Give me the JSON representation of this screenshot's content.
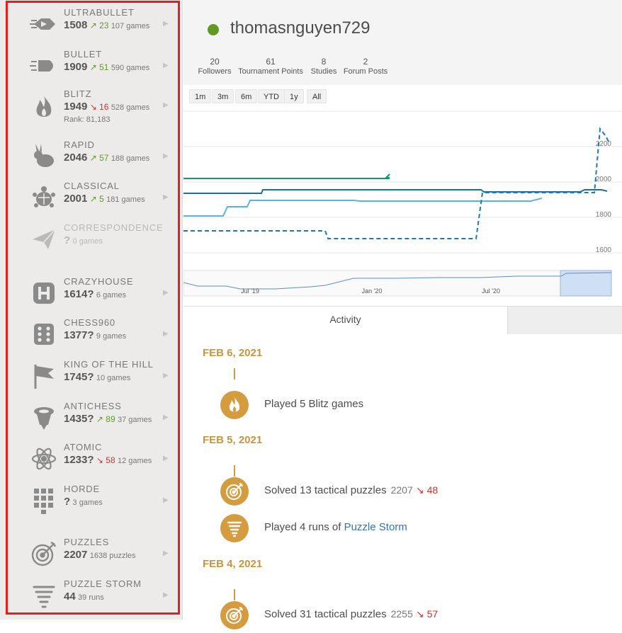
{
  "user": {
    "username": "thomasnguyen729",
    "online_color": "#629924"
  },
  "stats": [
    {
      "value": "20",
      "label": "Followers"
    },
    {
      "value": "61",
      "label": "Tournament Points"
    },
    {
      "value": "8",
      "label": "Studies"
    },
    {
      "value": "2",
      "label": "Forum Posts"
    }
  ],
  "perfs": [
    {
      "name": "ULTRABULLET",
      "rating": "1508",
      "dir": "up",
      "prog": "23",
      "games": "107 games",
      "icon": "ultrabullet-icon"
    },
    {
      "name": "BULLET",
      "rating": "1909",
      "dir": "up",
      "prog": "51",
      "games": "590 games",
      "icon": "bullet-icon"
    },
    {
      "name": "BLITZ",
      "rating": "1949",
      "dir": "down",
      "prog": "16",
      "games": "528 games",
      "rank": "Rank: 81,183",
      "icon": "blitz-fire-icon"
    },
    {
      "name": "RAPID",
      "rating": "2046",
      "dir": "up",
      "prog": "57",
      "games": "188 games",
      "icon": "rapid-rabbit-icon"
    },
    {
      "name": "CLASSICAL",
      "rating": "2001",
      "dir": "up",
      "prog": "5",
      "games": "181 games",
      "icon": "classical-turtle-icon"
    },
    {
      "name": "CORRESPONDENCE",
      "rating": "?",
      "games": "0 games",
      "icon": "correspondence-plane-icon"
    },
    {
      "name": "CRAZYHOUSE",
      "rating": "1614?",
      "games": "6 games",
      "icon": "crazyhouse-icon"
    },
    {
      "name": "CHESS960",
      "rating": "1377?",
      "games": "9 games",
      "icon": "chess960-dice-icon"
    },
    {
      "name": "KING OF THE HILL",
      "rating": "1745?",
      "games": "10 games",
      "icon": "king-of-the-hill-flag-icon"
    },
    {
      "name": "ANTICHESS",
      "rating": "1435?",
      "dir": "up",
      "prog": "89",
      "games": "37 games",
      "icon": "antichess-icon"
    },
    {
      "name": "ATOMIC",
      "rating": "1233?",
      "dir": "down",
      "prog": "58",
      "games": "12 games",
      "icon": "atomic-icon"
    },
    {
      "name": "HORDE",
      "rating": "?",
      "games": "3 games",
      "icon": "horde-icon"
    },
    {
      "name": "PUZZLES",
      "rating": "2207",
      "games": "1638 puzzles",
      "icon": "puzzle-target-icon"
    },
    {
      "name": "PUZZLE STORM",
      "rating": "44",
      "games": "39 runs",
      "icon": "puzzle-storm-icon"
    }
  ],
  "chart": {
    "ranges": [
      "1m",
      "3m",
      "6m",
      "YTD",
      "1y",
      "All"
    ],
    "y_ticks": [
      "2200",
      "2000",
      "1800",
      "1600"
    ],
    "nav_ticks": [
      "Jul '19",
      "Jan '20",
      "Jul '20"
    ],
    "colors": {
      "green": "#0c9b6a",
      "dark_blue": "#1c6fa3",
      "light_blue": "#56b4e3",
      "dashed": "#1f78b4"
    }
  },
  "activity": {
    "tab_label": "Activity",
    "days": [
      {
        "date": "FEB 6, 2021",
        "entries": [
          {
            "text": "Played 5 Blitz games",
            "icon": "blitz-fire-icon"
          }
        ]
      },
      {
        "date": "FEB 5, 2021",
        "entries": [
          {
            "text": "Solved 13 tactical puzzles",
            "score": "2207",
            "delta": "48",
            "icon": "puzzle-target-icon"
          },
          {
            "text": "Played 4 runs of ",
            "link": "Puzzle Storm",
            "icon": "puzzle-storm-icon"
          }
        ]
      },
      {
        "date": "FEB 4, 2021",
        "entries": [
          {
            "text": "Solved 31 tactical puzzles",
            "score": "2255",
            "delta": "57",
            "icon": "puzzle-target-icon"
          }
        ]
      }
    ]
  }
}
